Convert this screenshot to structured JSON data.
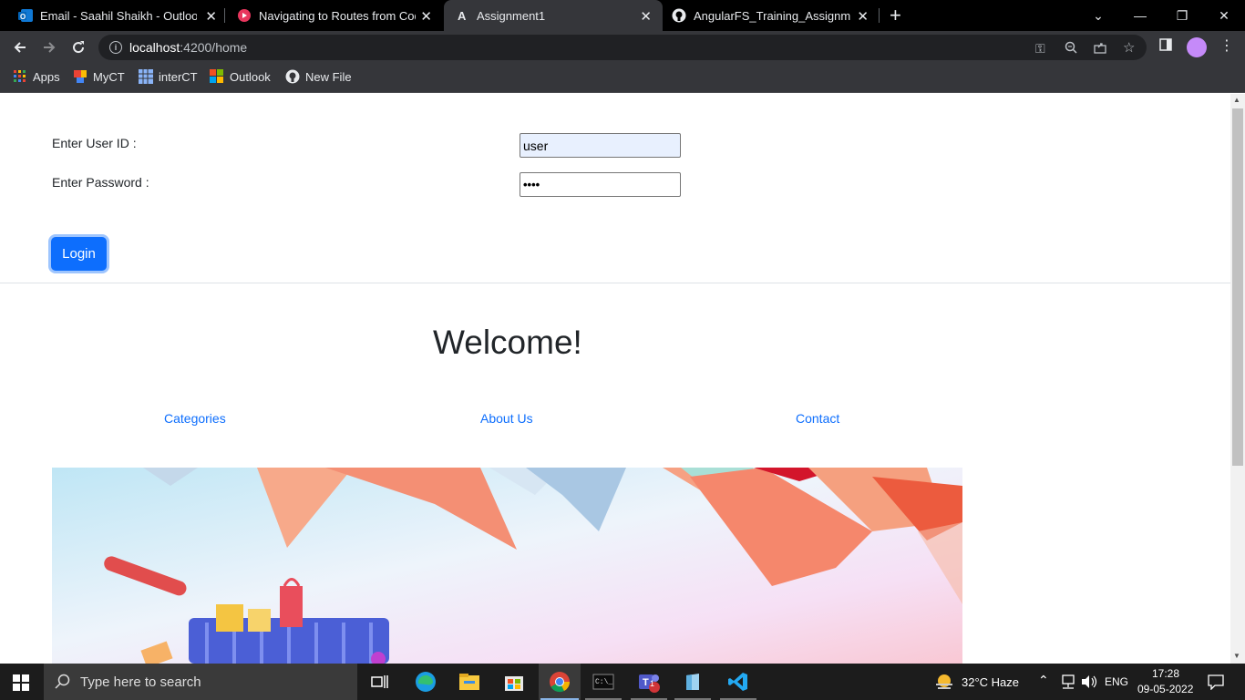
{
  "browser": {
    "tabs": [
      {
        "title": "Email - Saahil Shaikh - Outlook",
        "icon": "outlook-icon"
      },
      {
        "title": "Navigating to Routes from Code",
        "icon": "video-icon"
      },
      {
        "title": "Assignment1",
        "icon": "angular-icon"
      },
      {
        "title": "AngularFS_Training_Assignments",
        "icon": "github-icon"
      }
    ],
    "url_host": "localhost",
    "url_rest": ":4200/home",
    "bookmarks": [
      "Apps",
      "MyCT",
      "interCT",
      "Outlook",
      "New File"
    ]
  },
  "login": {
    "user_label": "Enter User ID :",
    "user_value": "user",
    "password_label": "Enter Password :",
    "password_value": "••••",
    "login_button": "Login"
  },
  "home": {
    "welcome": "Welcome!",
    "links": [
      "Categories",
      "About Us",
      "Contact"
    ]
  },
  "taskbar": {
    "search_placeholder": "Type here to search",
    "weather": "32°C  Haze",
    "language": "ENG",
    "time": "17:28",
    "date": "09-05-2022",
    "teams_badge": "1"
  }
}
